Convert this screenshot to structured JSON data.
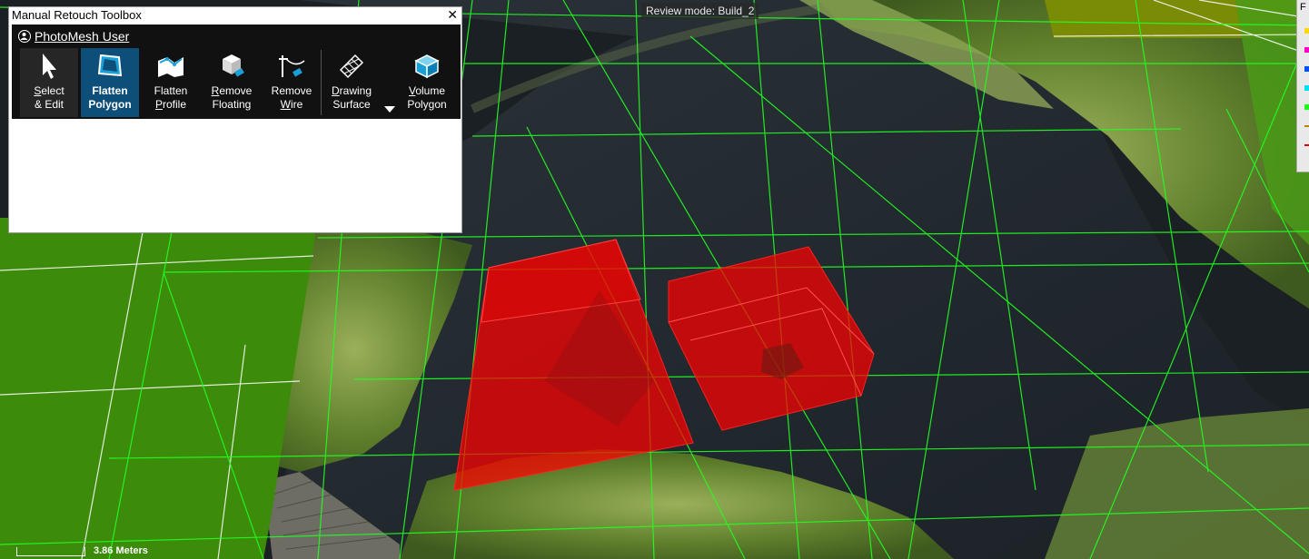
{
  "toolbox": {
    "title": "Manual Retouch Toolbox",
    "close_glyph": "✕",
    "user": "PhotoMesh User",
    "buttons": [
      {
        "key": "select",
        "first": "S",
        "rest1": "elect",
        "line2": "& Edit",
        "icon": "cursor-icon"
      },
      {
        "key": "flatten-polygon",
        "first": "",
        "rest1": "Flatten",
        "line2": "Polygon",
        "icon": "flatten-polygon-icon",
        "active": true
      },
      {
        "key": "flatten-profile",
        "line1": "Flatten",
        "first2": "P",
        "rest2": "rofile",
        "icon": "flatten-profile-icon"
      },
      {
        "key": "remove-floating",
        "first": "R",
        "rest1": "emove",
        "line2": "Floating",
        "icon": "remove-floating-icon"
      },
      {
        "key": "remove-wire",
        "line1": "Remove",
        "first2": "W",
        "rest2": "ire",
        "icon": "remove-wire-icon"
      },
      {
        "key": "drawing-surface",
        "first": "D",
        "rest1": "rawing",
        "line2": "Surface",
        "icon": "drawing-surface-icon"
      },
      {
        "key": "volume-polygon",
        "first": "V",
        "rest1": "olume",
        "line2": "Polygon",
        "icon": "volume-polygon-icon"
      }
    ]
  },
  "review_mode": "Review mode: Build_2",
  "legend": {
    "header_char": "F",
    "colors": [
      "#ffd800",
      "#ff00c8",
      "#0050ff",
      "#00e0ff",
      "#18ff18",
      "#b8860b",
      "#e00000"
    ]
  },
  "scale_text": "3.86 Meters",
  "colors": {
    "water": "#232a30",
    "vegetation": "#6f8d3a",
    "grid": "#22ff22",
    "volume": "#ff0000",
    "active_button": "#0d4f79",
    "terrain_plane": "#3d8b0a",
    "terrain_plane_right": "#7a8c05"
  }
}
